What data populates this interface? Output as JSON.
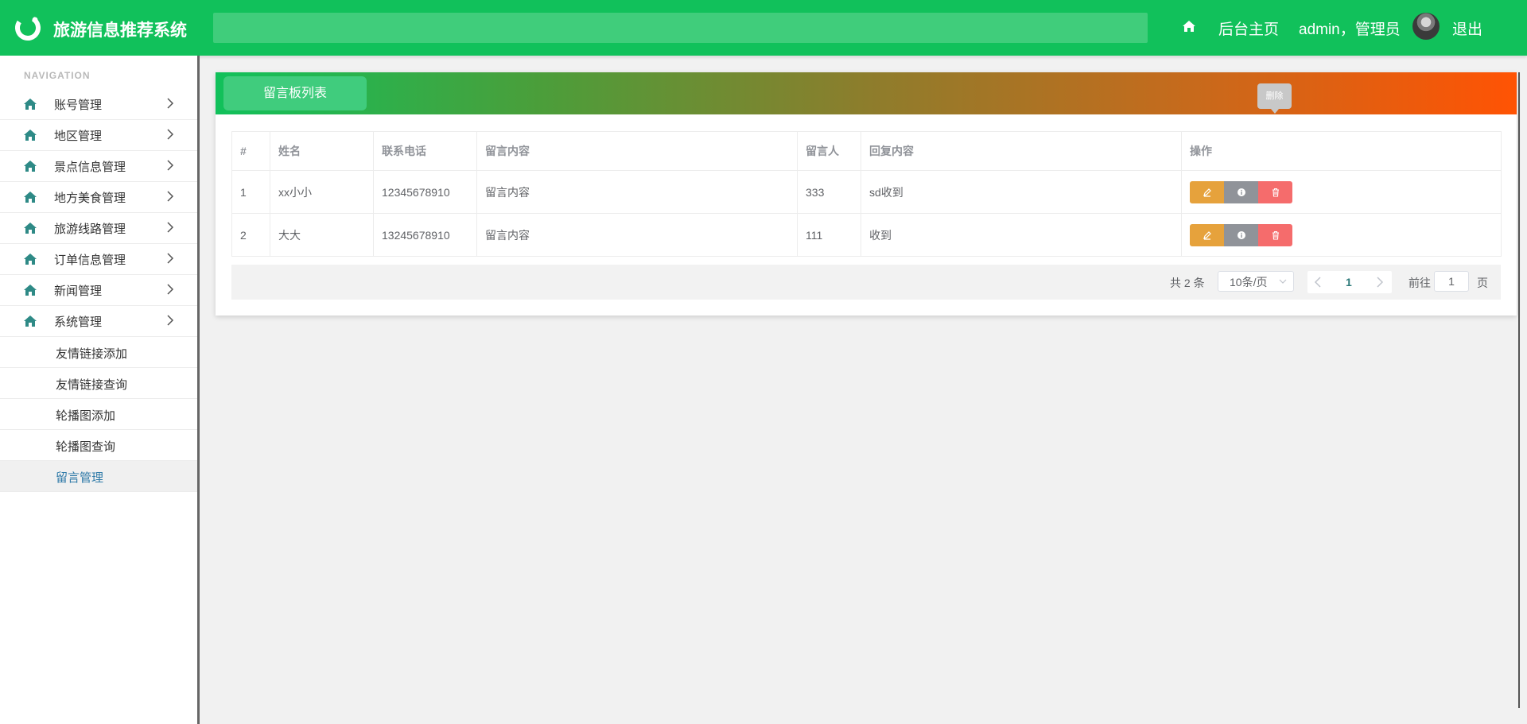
{
  "header": {
    "app_title": "旅游信息推荐系统",
    "nav_home": "后台主页",
    "user": "admin，管理员",
    "logout": "退出",
    "brand_color": "#11c15b"
  },
  "sidebar": {
    "caption": "NAVIGATION",
    "items": [
      {
        "label": "账号管理",
        "icon": "home-icon"
      },
      {
        "label": "地区管理",
        "icon": "home-icon"
      },
      {
        "label": "景点信息管理",
        "icon": "home-icon"
      },
      {
        "label": "地方美食管理",
        "icon": "home-icon"
      },
      {
        "label": "旅游线路管理",
        "icon": "home-icon"
      },
      {
        "label": "订单信息管理",
        "icon": "home-icon"
      },
      {
        "label": "新闻管理",
        "icon": "home-icon"
      },
      {
        "label": "系统管理",
        "icon": "home-icon"
      }
    ],
    "sub_items": [
      {
        "label": "友情链接添加"
      },
      {
        "label": "友情链接查询"
      },
      {
        "label": "轮播图添加"
      },
      {
        "label": "轮播图查询"
      },
      {
        "label": "留言管理",
        "active": true
      }
    ]
  },
  "panel": {
    "tab_label": "留言板列表",
    "table": {
      "headers": [
        "#",
        "姓名",
        "联系电话",
        "留言内容",
        "留言人",
        "回复内容",
        "操作"
      ],
      "rows": [
        [
          "1",
          "xx小小",
          "12345678910",
          "留言内容",
          "333",
          "sd收到"
        ],
        [
          "2",
          "大大",
          "13245678910",
          "留言内容",
          "111",
          "收到"
        ]
      ]
    },
    "tooltip": "删除",
    "pager": {
      "total": "共 2 条",
      "page_size": "10条/页",
      "current_page": "1",
      "goto_label": "前往",
      "goto_value": "1",
      "page_suffix": "页"
    }
  }
}
